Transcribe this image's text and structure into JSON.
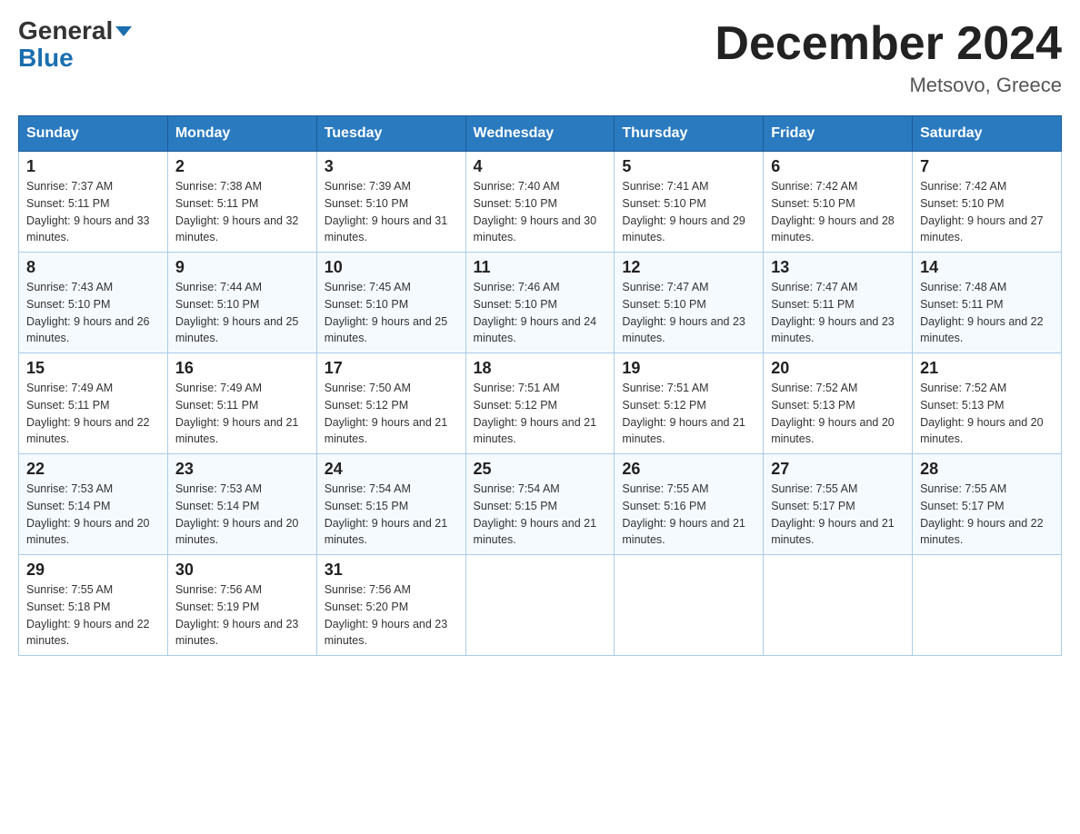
{
  "header": {
    "logo_line1": "General",
    "logo_line2": "Blue",
    "month": "December 2024",
    "location": "Metsovo, Greece"
  },
  "days_of_week": [
    "Sunday",
    "Monday",
    "Tuesday",
    "Wednesday",
    "Thursday",
    "Friday",
    "Saturday"
  ],
  "weeks": [
    [
      {
        "num": "1",
        "sunrise": "7:37 AM",
        "sunset": "5:11 PM",
        "daylight": "9 hours and 33 minutes."
      },
      {
        "num": "2",
        "sunrise": "7:38 AM",
        "sunset": "5:11 PM",
        "daylight": "9 hours and 32 minutes."
      },
      {
        "num": "3",
        "sunrise": "7:39 AM",
        "sunset": "5:10 PM",
        "daylight": "9 hours and 31 minutes."
      },
      {
        "num": "4",
        "sunrise": "7:40 AM",
        "sunset": "5:10 PM",
        "daylight": "9 hours and 30 minutes."
      },
      {
        "num": "5",
        "sunrise": "7:41 AM",
        "sunset": "5:10 PM",
        "daylight": "9 hours and 29 minutes."
      },
      {
        "num": "6",
        "sunrise": "7:42 AM",
        "sunset": "5:10 PM",
        "daylight": "9 hours and 28 minutes."
      },
      {
        "num": "7",
        "sunrise": "7:42 AM",
        "sunset": "5:10 PM",
        "daylight": "9 hours and 27 minutes."
      }
    ],
    [
      {
        "num": "8",
        "sunrise": "7:43 AM",
        "sunset": "5:10 PM",
        "daylight": "9 hours and 26 minutes."
      },
      {
        "num": "9",
        "sunrise": "7:44 AM",
        "sunset": "5:10 PM",
        "daylight": "9 hours and 25 minutes."
      },
      {
        "num": "10",
        "sunrise": "7:45 AM",
        "sunset": "5:10 PM",
        "daylight": "9 hours and 25 minutes."
      },
      {
        "num": "11",
        "sunrise": "7:46 AM",
        "sunset": "5:10 PM",
        "daylight": "9 hours and 24 minutes."
      },
      {
        "num": "12",
        "sunrise": "7:47 AM",
        "sunset": "5:10 PM",
        "daylight": "9 hours and 23 minutes."
      },
      {
        "num": "13",
        "sunrise": "7:47 AM",
        "sunset": "5:11 PM",
        "daylight": "9 hours and 23 minutes."
      },
      {
        "num": "14",
        "sunrise": "7:48 AM",
        "sunset": "5:11 PM",
        "daylight": "9 hours and 22 minutes."
      }
    ],
    [
      {
        "num": "15",
        "sunrise": "7:49 AM",
        "sunset": "5:11 PM",
        "daylight": "9 hours and 22 minutes."
      },
      {
        "num": "16",
        "sunrise": "7:49 AM",
        "sunset": "5:11 PM",
        "daylight": "9 hours and 21 minutes."
      },
      {
        "num": "17",
        "sunrise": "7:50 AM",
        "sunset": "5:12 PM",
        "daylight": "9 hours and 21 minutes."
      },
      {
        "num": "18",
        "sunrise": "7:51 AM",
        "sunset": "5:12 PM",
        "daylight": "9 hours and 21 minutes."
      },
      {
        "num": "19",
        "sunrise": "7:51 AM",
        "sunset": "5:12 PM",
        "daylight": "9 hours and 21 minutes."
      },
      {
        "num": "20",
        "sunrise": "7:52 AM",
        "sunset": "5:13 PM",
        "daylight": "9 hours and 20 minutes."
      },
      {
        "num": "21",
        "sunrise": "7:52 AM",
        "sunset": "5:13 PM",
        "daylight": "9 hours and 20 minutes."
      }
    ],
    [
      {
        "num": "22",
        "sunrise": "7:53 AM",
        "sunset": "5:14 PM",
        "daylight": "9 hours and 20 minutes."
      },
      {
        "num": "23",
        "sunrise": "7:53 AM",
        "sunset": "5:14 PM",
        "daylight": "9 hours and 20 minutes."
      },
      {
        "num": "24",
        "sunrise": "7:54 AM",
        "sunset": "5:15 PM",
        "daylight": "9 hours and 21 minutes."
      },
      {
        "num": "25",
        "sunrise": "7:54 AM",
        "sunset": "5:15 PM",
        "daylight": "9 hours and 21 minutes."
      },
      {
        "num": "26",
        "sunrise": "7:55 AM",
        "sunset": "5:16 PM",
        "daylight": "9 hours and 21 minutes."
      },
      {
        "num": "27",
        "sunrise": "7:55 AM",
        "sunset": "5:17 PM",
        "daylight": "9 hours and 21 minutes."
      },
      {
        "num": "28",
        "sunrise": "7:55 AM",
        "sunset": "5:17 PM",
        "daylight": "9 hours and 22 minutes."
      }
    ],
    [
      {
        "num": "29",
        "sunrise": "7:55 AM",
        "sunset": "5:18 PM",
        "daylight": "9 hours and 22 minutes."
      },
      {
        "num": "30",
        "sunrise": "7:56 AM",
        "sunset": "5:19 PM",
        "daylight": "9 hours and 23 minutes."
      },
      {
        "num": "31",
        "sunrise": "7:56 AM",
        "sunset": "5:20 PM",
        "daylight": "9 hours and 23 minutes."
      },
      null,
      null,
      null,
      null
    ]
  ]
}
